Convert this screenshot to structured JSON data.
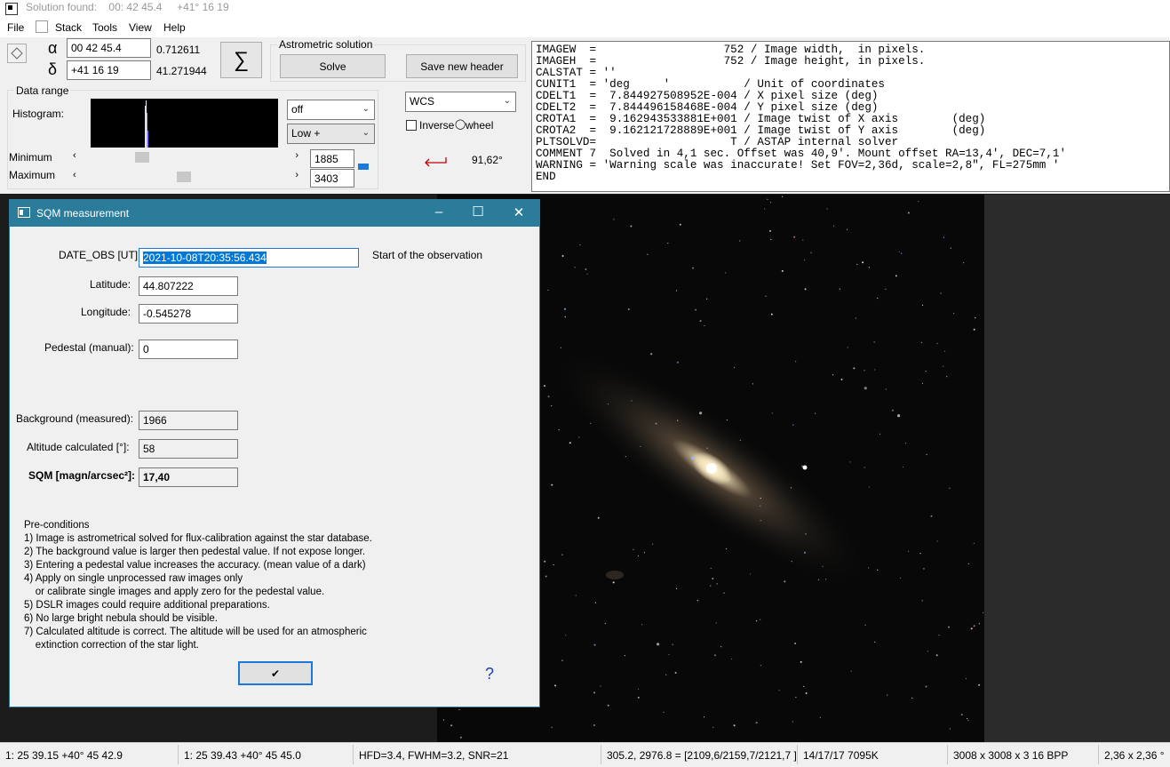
{
  "window": {
    "title": "Solution found:    00: 42 45.4     +41° 16 19"
  },
  "menu": {
    "file": "File",
    "stack": "Stack",
    "tools": "Tools",
    "view": "View",
    "help": "Help"
  },
  "coords": {
    "alpha_symbol": "α",
    "delta_symbol": "δ",
    "ra_value": "00 42 45.4",
    "ra_decimal": "0.712611",
    "dec_value": "+41 16 19",
    "dec_decimal": "41.271944",
    "sigma": "∑"
  },
  "astrometric": {
    "group_label": "Astrometric solution",
    "solve_label": "Solve",
    "save_header_label": "Save new header"
  },
  "data_range": {
    "group_label": "Data range",
    "histogram_label": "Histogram:",
    "min_label": "Minimum",
    "max_label": "Maximum",
    "min_value": "1885",
    "max_value": "3403",
    "stretch_select": "off",
    "range_select": "Low +"
  },
  "wcs": {
    "select_value": "WCS",
    "inverse_label": "Inverse",
    "wheel_label": "wheel",
    "angle": "91,62°"
  },
  "header_lines": [
    "IMAGEW  =                   752 / Image width,  in pixels.",
    "IMAGEH  =                   752 / Image height, in pixels.",
    "CALSTAT = ''",
    "CUNIT1  = 'deg     '           / Unit of coordinates",
    "CDELT1  =  7.844927508952E-004 / X pixel size (deg)",
    "CDELT2  =  7.844496158468E-004 / Y pixel size (deg)",
    "CROTA1  =  9.162943533881E+001 / Image twist of X axis        (deg)",
    "CROTA2  =  9.162121728889E+001 / Image twist of Y axis        (deg)",
    "PLTSOLVD=                    T / ASTAP internal solver",
    "COMMENT 7  Solved in 4,1 sec. Offset was 40,9'. Mount offset RA=13,4', DEC=7,1'",
    "WARNING = 'Warning scale was inaccurate! Set FOV=2,36d, scale=2,8\", FL=275mm '",
    "END"
  ],
  "dialog": {
    "title": "SQM measurement",
    "date_label": "DATE_OBS [UT]:",
    "date_value": "2021-10-08T20:35:56.434",
    "date_hint": "Start of the observation",
    "lat_label": "Latitude:",
    "lat_value": "44.807222",
    "lon_label": "Longitude:",
    "lon_value": "-0.545278",
    "pedestal_label": "Pedestal (manual):",
    "pedestal_value": "0",
    "background_label": "Background (measured):",
    "background_value": "1966",
    "altitude_label": "Altitude calculated [°]:",
    "altitude_value": "58",
    "sqm_label": "SQM [magn/arcsec²]:",
    "sqm_value": "17,40",
    "preconditions": "Pre-conditions\n1) Image is astrometrical solved for flux-calibration against the star database.\n2) The background value is larger then pedestal value. If not expose longer.\n3) Entering a pedestal value increases the accuracy. (mean value of a dark)\n4) Apply on single unprocessed raw images only\n    or calibrate single images and apply zero for the pedestal value.\n5) DSLR images could require additional preparations.\n6) No large bright nebula should be visible.\n7) Calculated altitude is correct. The altitude will be used for an atmospheric\n    extinction correction of the star light.",
    "ok_symbol": "✔",
    "help_symbol": "?"
  },
  "status": {
    "c1": "1: 25  39.15   +40° 45  42.9",
    "c2": "1: 25  39.43   +40° 45  45.0",
    "c3": "HFD=3.4, FWHM=3.2, SNR=21",
    "c4": "305.2, 2976.8 = [2109,6/2159,7/2121,7 ]",
    "c5": "14/17/17  7095K",
    "c6": "3008 x 3008 x 3   16 BPP",
    "c7": "2,36 x 2,36 °"
  }
}
